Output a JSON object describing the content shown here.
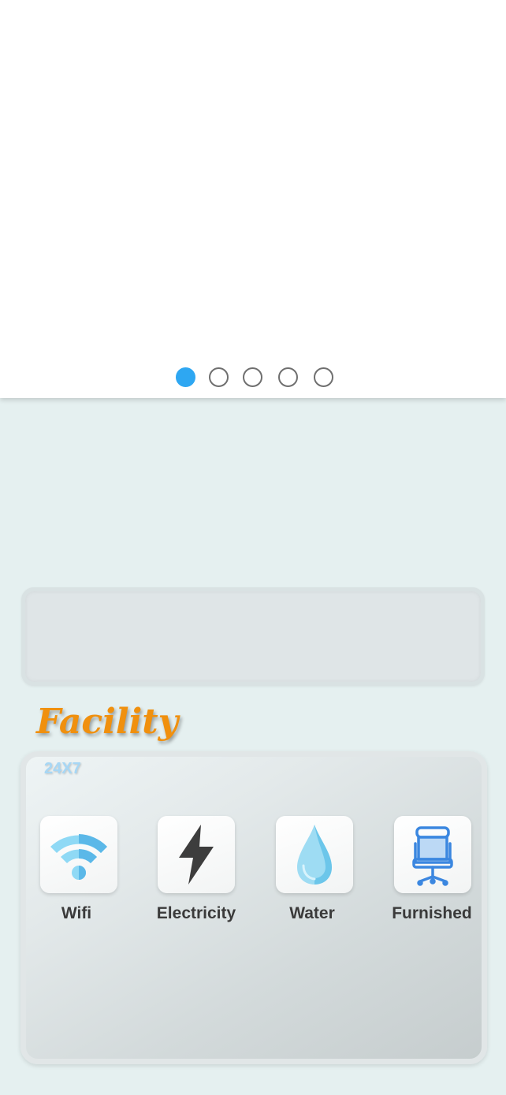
{
  "carousel": {
    "slides": 5,
    "active_index": 0,
    "colors": {
      "active": "#2ea7f2",
      "inactive_border": "#6f6f6f"
    }
  },
  "facility": {
    "title": "Facility",
    "badge": "24X7",
    "title_color": "#f0900e",
    "badge_color": "#a7d7f5",
    "items": [
      {
        "label": "Wifi",
        "icon": "wifi-icon"
      },
      {
        "label": "Electricity",
        "icon": "lightning-bolt-icon"
      },
      {
        "label": "Water",
        "icon": "water-drop-icon"
      },
      {
        "label": "Furnished",
        "icon": "office-chair-icon"
      }
    ]
  }
}
